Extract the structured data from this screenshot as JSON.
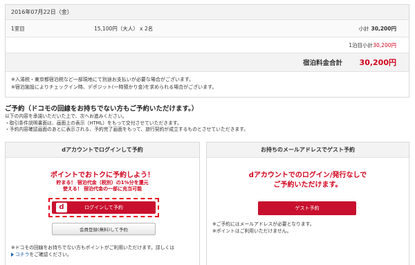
{
  "summary": {
    "date": "2016年07月22日（金）",
    "room": {
      "label": "1室目",
      "detail": "15,100円（大人） x 2名",
      "subtotal_label": "小計",
      "subtotal_value": "30,200円"
    },
    "night": {
      "label": "1泊目小計",
      "value": "30,200円"
    },
    "total": {
      "label": "宿泊料金合計",
      "value": "30,200円"
    },
    "notes": [
      "※入湯税・東京都宿泊税など一部現地にて別途お支払いが必要な場合がございます。",
      "※宿泊施設によりチェックイン時、デポジット(一時預かり金)を求められる場合がございます。"
    ]
  },
  "booking": {
    "heading": "ご予約（ドコモの回線をお持ちでない方もご予約いただけます。）",
    "intro": [
      "以下の内容を承諾いただいた上で、次へお進みください。",
      "・取引条件説明書面は、画面上の表示（HTML）をもって交付させていただきます。",
      "・予約内容確認画面のあとに表示される、予約完了画面をもって、旅行契約が成立するものとさせていただきます。"
    ]
  },
  "left_panel": {
    "title": "dアカウントでログインして予約",
    "promo_title": "ポイントでおトクに予約しよう！",
    "promo_lines": [
      "貯まる！ 宿泊代金（税別）の1%分を還元",
      "使える！ 宿泊代金の一部に充当可能"
    ],
    "d_icon_letter": "d",
    "login_label": "ログインして予約",
    "register_label": "会員登録(無料)して予約",
    "note": "※ドコモの回線をお持ちでない方もポイントがご利用いただけます。詳しくは",
    "link_label": "コチラ",
    "note_suffix": "をご確認ください。"
  },
  "right_panel": {
    "title": "お持ちのメールアドレスでゲスト予約",
    "guest_title_1": "dアカウントでのログイン/発行なしで",
    "guest_title_2": "ご予約いただけます。",
    "guest_label": "ゲスト予約",
    "notes": [
      "※ご予約にはメールアドレスが必要となります。",
      "※ポイントはご利用いただけません。"
    ]
  },
  "colors": {
    "accent_red": "#c8102e",
    "text_red": "#d0021b",
    "link_blue": "#1a5fb4"
  }
}
